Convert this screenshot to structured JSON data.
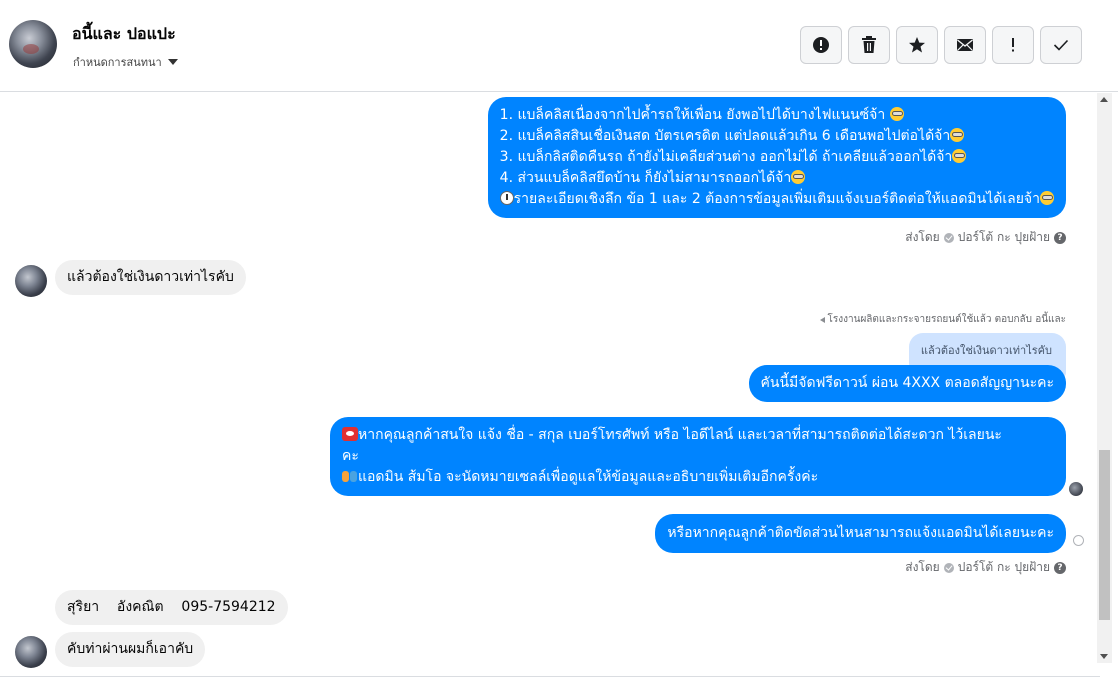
{
  "header": {
    "contact_name": "อนี้และ ปอแปะ",
    "conversation_menu": "กำหนดการสนทนา"
  },
  "toolbar": {
    "buttons": [
      {
        "name": "mark-spam",
        "icon": "alert-circle-icon"
      },
      {
        "name": "delete",
        "icon": "trash-icon"
      },
      {
        "name": "star",
        "icon": "star-icon"
      },
      {
        "name": "mark-unread",
        "icon": "envelope-icon"
      },
      {
        "name": "important",
        "icon": "exclamation-icon"
      },
      {
        "name": "done",
        "icon": "check-icon"
      }
    ]
  },
  "messages": {
    "m1": {
      "lines": [
        "1. แบล็คลิสเนื่องจากไปค้ำรถให้เพื่อน ยังพอไปได้บางไฟแนนซ์จ้า",
        "2. แบล็คลิสสินเชื่อเงินสด บัตรเครดิต แต่ปลดแล้วเกิน 6 เดือนพอไปต่อได้จ้า",
        "3. แบล็กลิสติดคืนรถ ถ้ายังไม่เคลียส่วนต่าง ออกไม่ได้ ถ้าเคลียแล้วออกได้จ้า",
        "4. ส่วนแบล็คลิสยึดบ้าน ก็ยังไม่สามารถออกได้จ้า",
        "รายละเอียดเชิงลึก ข้อ 1 และ 2 ต้องการข้อมูลเพิ่มเติมแจ้งเบอร์ติดต่อให้แอดมินได้เลยจ้า"
      ]
    },
    "sent_by_label": "ส่งโดย",
    "sent_by_name": "ปอร์โต้ กะ ปุยฝ้าย",
    "m2": "แล้วต้องใช่เงินดาวเท่าไรคับ",
    "reply_note": "โรงงานผลิตและกระจายรถยนต์ใช้แล้ว ตอบกลับ อนี้และ",
    "quoted": "แล้วต้องใช่เงินดาวเท่าไรคับ",
    "m3": "คันนี้มีจัดฟรีดาวน์ ผ่อน 4XXX ตลอดสัญญานะคะ",
    "m4": {
      "line1": "หากคุณลูกค้าสนใจ แจ้ง ชื่อ - สกุล เบอร์โทรศัพท์ หรือ ไอดีไลน์ และเวลาที่สามารถติดต่อได้สะดวก ไว้เลยนะ",
      "line2": "คะ",
      "line3": "แอดมิน ส้มโอ จะนัดหมายเซลล์เพื่อดูแลให้ข้อมูลและอธิบายเพิ่มเติมอีกครั้งค่ะ"
    },
    "m5": "หรือหากคุณลูกค้าติดขัดส่วนไหนสามารถแจ้งแอดมินได้เลยนะคะ",
    "m6": "สุริยา    อังคณิต    095-7594212",
    "m7": "คับท่าผ่านผมก็เอาคับ"
  }
}
